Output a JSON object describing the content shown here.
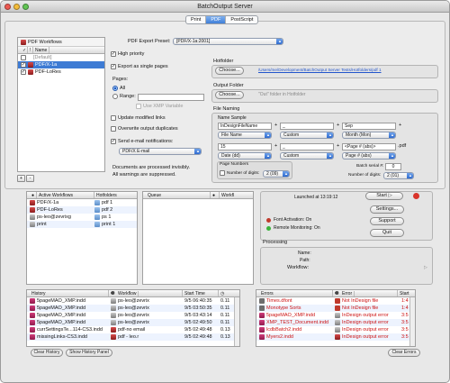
{
  "window": {
    "title": "BatchOutput Server",
    "tabs": [
      {
        "label": "Print",
        "active": false
      },
      {
        "label": "PDF",
        "active": true
      },
      {
        "label": "PostScript",
        "active": false
      }
    ]
  },
  "workflows": {
    "header_name": "Name",
    "title": "PDF Workflows",
    "items": [
      {
        "name": "[Default]",
        "checked": false,
        "selected": false,
        "muted": true
      },
      {
        "name": "PDF/X-1a",
        "checked": true,
        "selected": true,
        "muted": false
      },
      {
        "name": "PDF-LoRes",
        "checked": true,
        "selected": false,
        "muted": false
      }
    ],
    "add_label": "+",
    "remove_label": "-"
  },
  "pdf_options": {
    "preset_label": "PDF Export Preset:",
    "preset_value": "[PDF/X-1a:2001]",
    "high_priority": "High priority",
    "export_single": "Export as single pages",
    "pages_label": "Pages:",
    "pages_all": "All",
    "pages_range": "Range:",
    "use_xmp": "Use XMP Variable",
    "update_links": "Update modified links",
    "overwrite": "Overwrite output duplicates",
    "send_email": "Send e-mail notifications:",
    "email_value": "PDF/X E-mail",
    "note_1": "Documents are processed invisibly.",
    "note_2": "All warnings are suppressed."
  },
  "hotfolder": {
    "title": "Hotfolder",
    "choose": "Choose...",
    "path": "/Users/me/Development/BatchOutput Server Tests/Hotfolders/pdf 1"
  },
  "output_folder": {
    "title": "Output Folder",
    "choose": "Choose...",
    "hint": "\"Out\" folder in Hotfolder"
  },
  "file_naming": {
    "title": "File Naming",
    "sample_label": "Name Sample",
    "row1": [
      "InDesignFileName",
      "+",
      "_",
      "+",
      "Sep",
      "+"
    ],
    "row1_pops": [
      "File Name",
      "Custom",
      "Month (Mon)"
    ],
    "row2": [
      "15",
      "+",
      "_",
      "+",
      "<Page # (abs)>",
      ".pdf"
    ],
    "row2_pops": [
      "Date (dd)",
      "Custom",
      "Page # (abs)"
    ],
    "page_numbers_label": "Page Numbers",
    "number_of_digits": "Number of digits:",
    "number_of_digits_value": "2 (09)",
    "batch_serial_label": "Batch serial #:",
    "batch_serial_value": "0",
    "digits_label": "Number of digits:",
    "digits_value": "2 (01)"
  },
  "active_workflows": {
    "headers": [
      "",
      "Active Workflows",
      "Hotfolders"
    ],
    "rows": [
      {
        "name": "PDF/X-1a",
        "folder": "pdf 1",
        "icon": "pdf"
      },
      {
        "name": "PDF-LoRes",
        "folder": "pdf 2",
        "icon": "pdf"
      },
      {
        "name": "ps-leo@zevrixg",
        "folder": "ps 1",
        "icon": "ps"
      },
      {
        "name": "print",
        "folder": "print 1",
        "icon": "print"
      }
    ]
  },
  "queue": {
    "headers": [
      "Queue",
      "",
      "Workfl"
    ]
  },
  "status": {
    "launched": "Launched at 13:19:12",
    "font_activation": "Font Activation: On",
    "remote_monitoring": "Remote Monitoring: On",
    "start": "Start",
    "settings": "Settings...",
    "support": "Support",
    "quit": "Quit",
    "processing_title": "Processing",
    "name_label": "Name:",
    "path_label": "Path:",
    "workflow_label": "Workflow:"
  },
  "history": {
    "headers": [
      "History",
      "Workflow",
      "Start Time",
      ""
    ],
    "rows": [
      {
        "file": "5pageMAO_XMP.indd",
        "workflow": "ps-leo@zevrix",
        "time": "9/5 06:40:35",
        "dur": "0.11"
      },
      {
        "file": "5pageMAO_XMP.indd",
        "workflow": "ps-leo@zevrix",
        "time": "9/5 03:50:35",
        "dur": "0.11"
      },
      {
        "file": "5pageMAO_XMP.indd",
        "workflow": "ps-leo@zevrix",
        "time": "9/5 03:43:14",
        "dur": "0.11"
      },
      {
        "file": "5pageMAO_XMP.indd",
        "workflow": "ps-leo@zevrix",
        "time": "9/5 02:49:50",
        "dur": "0.11"
      },
      {
        "file": "currSettingsTe...114-CS3.indd",
        "workflow": "pdf-no email",
        "time": "9/5 02:49:48",
        "dur": "0.13"
      },
      {
        "file": "missingLinks-CS3.indd",
        "workflow": "pdf - leo.r",
        "time": "9/5 02:49:48",
        "dur": "0.13"
      }
    ],
    "clear": "Clear History",
    "show": "Show History Panel"
  },
  "errors": {
    "headers": [
      "Errors",
      "Error",
      "Start"
    ],
    "rows": [
      {
        "file": "Times.dfont",
        "error": "Not InDesign file",
        "time": "1:4"
      },
      {
        "file": "Monotype Sorts",
        "error": "Not InDesign file",
        "time": "1:4"
      },
      {
        "file": "5pageMAO_XMP.indd",
        "error": "InDesign output error",
        "time": "3:5"
      },
      {
        "file": "XMP_TEST_Document.indd",
        "error": "InDesign output error",
        "time": "3:5"
      },
      {
        "file": "lcdbBatch2.indd",
        "error": "InDesign output error",
        "time": "3:5"
      },
      {
        "file": "Myers2.indd",
        "error": "InDesign output error",
        "time": "3:5"
      }
    ],
    "clear": "Clear Errors"
  },
  "colors": {
    "selection": "#3d7bd4",
    "error_text": "#cc1111",
    "green_light": "#3bb33b",
    "red_stop": "#d9342b"
  }
}
